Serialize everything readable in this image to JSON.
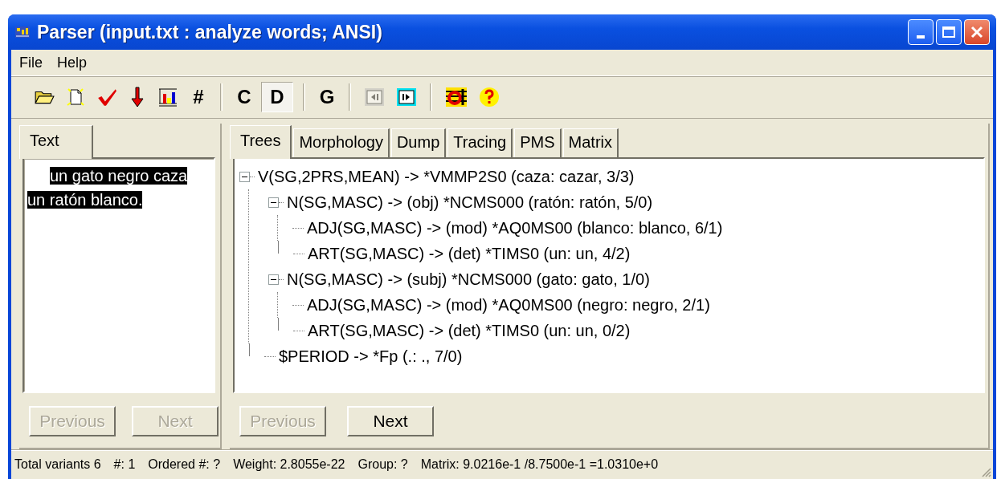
{
  "window": {
    "title": "Parser (input.txt : analyze words; ANSI)"
  },
  "menu": [
    {
      "label": "File"
    },
    {
      "label": "Help"
    }
  ],
  "toolbar": [
    {
      "kind": "icon"
    },
    {
      "kind": "icon"
    },
    {
      "kind": "icon"
    },
    {
      "kind": "icon"
    },
    {
      "kind": "icon"
    },
    {
      "kind": "text",
      "label": "#",
      "pressed": false
    },
    {
      "kind": "sep"
    },
    {
      "kind": "text",
      "label": "C",
      "pressed": false
    },
    {
      "kind": "text",
      "label": "D",
      "pressed": true
    },
    {
      "kind": "sep"
    },
    {
      "kind": "text",
      "label": "G",
      "pressed": false
    },
    {
      "kind": "sep"
    },
    {
      "kind": "icon",
      "disabled": true
    },
    {
      "kind": "icon",
      "disabled": false
    },
    {
      "kind": "sep"
    },
    {
      "kind": "icon"
    },
    {
      "kind": "icon"
    }
  ],
  "left_pane": {
    "tabs": [
      {
        "label": "Text",
        "selected": true
      }
    ],
    "text_lines": [
      "un gato negro caza",
      "un ratón blanco."
    ],
    "buttons": [
      {
        "label": "Previous",
        "disabled": true
      },
      {
        "label": "Next",
        "disabled": true
      }
    ]
  },
  "right_pane": {
    "tabs": [
      {
        "label": "Trees",
        "selected": true
      },
      {
        "label": "Morphology",
        "selected": false
      },
      {
        "label": "Dump",
        "selected": false
      },
      {
        "label": "Tracing",
        "selected": false
      },
      {
        "label": "PMS",
        "selected": false
      },
      {
        "label": "Matrix",
        "selected": false
      }
    ],
    "tree": [
      {
        "label": "V(SG,2PRS,MEAN) -> *VMMP2S0 (caza: cazar, 3/3)",
        "expanded": true,
        "children": [
          {
            "label": "N(SG,MASC) ->  (obj) *NCMS000 (ratón: ratón, 5/0)",
            "expanded": true,
            "children": [
              {
                "label": "ADJ(SG,MASC) ->  (mod) *AQ0MS00 (blanco: blanco, 6/1)"
              },
              {
                "label": "ART(SG,MASC) ->  (det) *TIMS0 (un: un, 4/2)"
              }
            ]
          },
          {
            "label": "N(SG,MASC) ->  (subj) *NCMS000 (gato: gato, 1/0)",
            "expanded": true,
            "children": [
              {
                "label": "ADJ(SG,MASC) ->  (mod) *AQ0MS00 (negro: negro, 2/1)"
              },
              {
                "label": "ART(SG,MASC) ->  (det) *TIMS0 (un: un, 0/2)"
              }
            ]
          },
          {
            "label": "$PERIOD -> *Fp (.: ., 7/0)"
          }
        ]
      }
    ],
    "buttons": [
      {
        "label": "Previous",
        "disabled": true
      },
      {
        "label": "Next",
        "disabled": false
      }
    ]
  },
  "status_bar": [
    "Total variants 6",
    "#: 1",
    "Ordered #: ?",
    "Weight: 2.8055e-22",
    "Group: ?",
    "Matrix: 9.0216e-1 /8.7500e-1 =1.0310e+0"
  ]
}
